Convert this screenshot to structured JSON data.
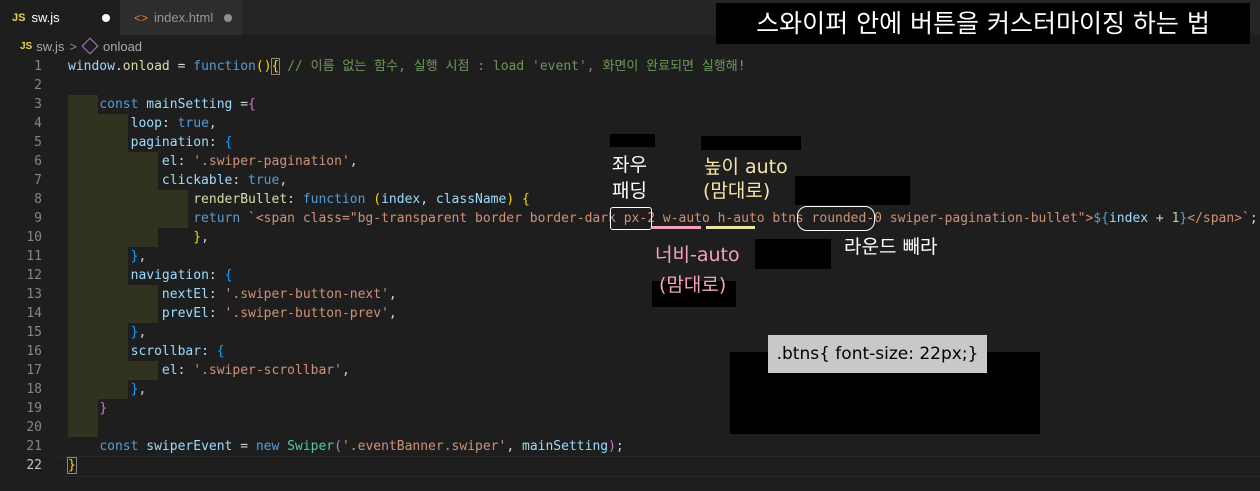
{
  "tabs": [
    {
      "badge": "JS",
      "label": "sw.js"
    },
    {
      "badge": "<>",
      "label": "index.html"
    }
  ],
  "breadcrumb": {
    "badge": "JS",
    "file": "sw.js",
    "sep": ">",
    "symbol": "onload"
  },
  "title_overlay": "스와이퍼 안에 버튼을 커스터마이징 하는 법",
  "line_numbers": [
    "1",
    "2",
    "3",
    "4",
    "5",
    "6",
    "7",
    "8",
    "9",
    "10",
    "11",
    "12",
    "13",
    "14",
    "15",
    "16",
    "17",
    "18",
    "19",
    "20",
    "21",
    "22"
  ],
  "annotations": {
    "padding_lr": "좌우\n패딩",
    "height_auto_1": "높이 auto",
    "height_auto_2": "(맘대로)",
    "width_auto_1": "너비-auto",
    "width_auto_2": "(맘대로)",
    "round_remove": "라운드 빼라",
    "btns_css": ".btns{ font-size: 22px;}"
  },
  "colors": {
    "editor_bg": "#1e1e1e",
    "tab_bg": "#252526",
    "pink_underline": "#f6a0c0",
    "yellow_underline": "#f0e0a0",
    "annot_pink": "#f6a0c0",
    "annot_yellow": "#f5e6a8"
  }
}
